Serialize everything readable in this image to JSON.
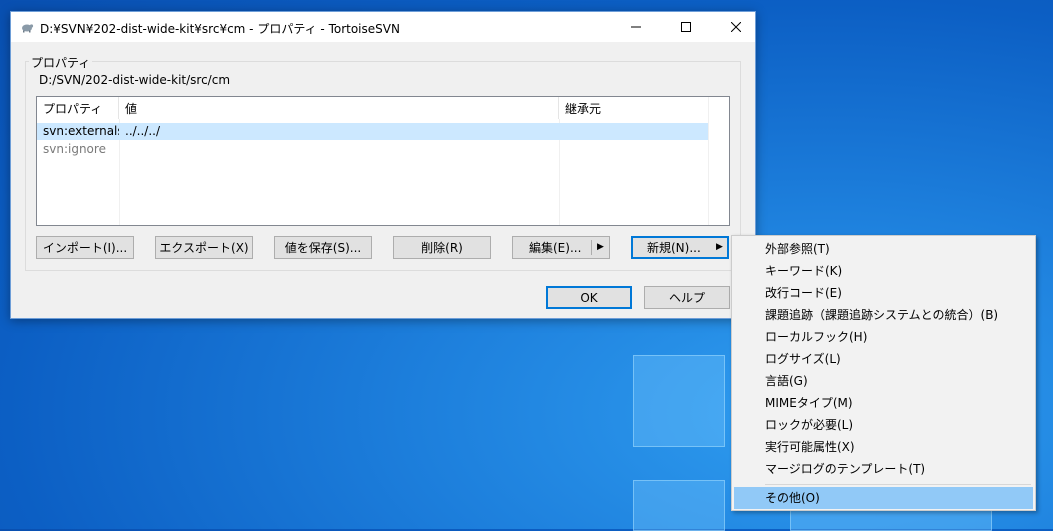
{
  "window": {
    "title": "D:¥SVN¥202-dist-wide-kit¥src¥cm - プロパティ - TortoiseSVN",
    "app_icon": "tortoise-icon",
    "controls": [
      "minimize-icon",
      "maximize-icon",
      "close-icon"
    ]
  },
  "properties_group": {
    "legend": "プロパティ",
    "path": "D:/SVN/202-dist-wide-kit/src/cm"
  },
  "table": {
    "columns": [
      "プロパティ",
      "値",
      "継承元"
    ],
    "rows": [
      {
        "property": "svn:externals",
        "value": "../../../",
        "inherited": "",
        "selected": true
      },
      {
        "property": "svn:ignore",
        "value": "",
        "inherited": "",
        "selected": false
      }
    ]
  },
  "buttons": {
    "import": "インポート(I)...",
    "export": "エクスポート(X)",
    "save_value": "値を保存(S)...",
    "delete": "削除(R)",
    "edit": "編集(E)...",
    "new": "新規(N)...",
    "ok": "OK",
    "help": "ヘルプ"
  },
  "new_menu": {
    "items": [
      "外部参照(T)",
      "キーワード(K)",
      "改行コード(E)",
      "課題追跡（課題追跡システムとの統合）(B)",
      "ローカルフック(H)",
      "ログサイズ(L)",
      "言語(G)",
      "MIMEタイプ(M)",
      "ロックが必要(L)",
      "実行可能属性(X)",
      "マージログのテンプレート(T)"
    ],
    "other": "その他(O)"
  },
  "colors": {
    "selection": "#cce8ff",
    "menu_highlight": "#91c9f7",
    "accent": "#0078d7"
  }
}
